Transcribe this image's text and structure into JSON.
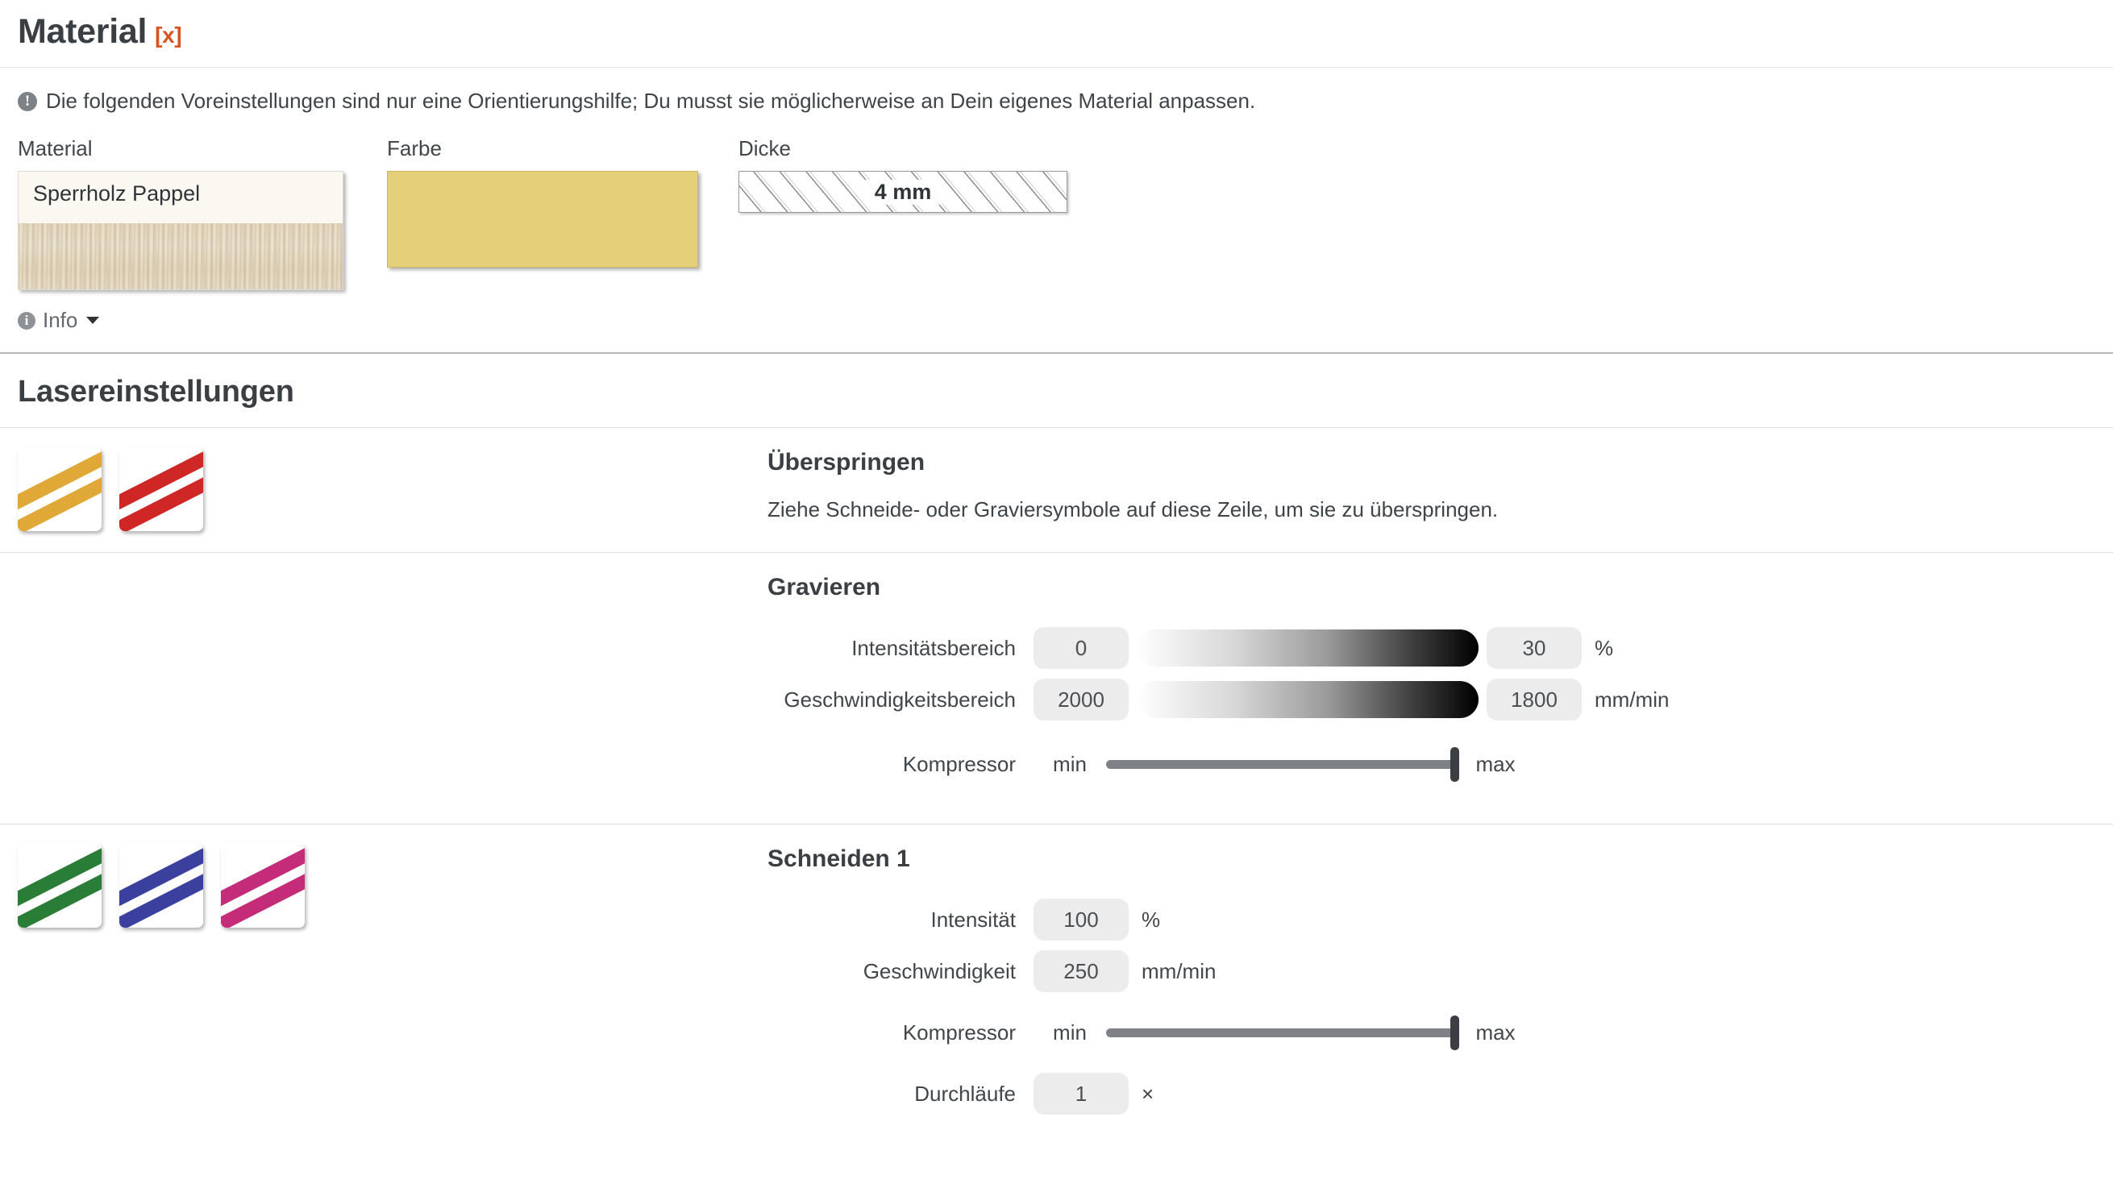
{
  "material_section": {
    "title": "Material",
    "close_tag": "[x]",
    "notice": {
      "icon": "exclamation-circle-icon",
      "text": "Die folgenden Voreinstellungen sind nur eine Orientierungshilfe; Du musst sie möglicherweise an Dein eigenes Material anpassen."
    },
    "fields": {
      "material": {
        "label": "Material",
        "value": "Sperrholz Pappel"
      },
      "color": {
        "label": "Farbe",
        "value_hex": "#e4d078"
      },
      "thickness": {
        "label": "Dicke",
        "value": "4 mm"
      }
    },
    "info_toggle": {
      "label": "Info",
      "icon": "info-circle-icon",
      "caret": "chevron-down-icon"
    }
  },
  "laser_section": {
    "title": "Lasereinstellungen",
    "rows": [
      {
        "id": "skip",
        "title": "Überspringen",
        "description": "Ziehe Schneide- oder Graviersymbole auf diese Zeile, um sie zu überspringen.",
        "tiles": [
          {
            "name": "stripe-tile-orange",
            "color": "#e0a836"
          },
          {
            "name": "stripe-tile-red",
            "color": "#cf2626"
          }
        ],
        "params": []
      },
      {
        "id": "engrave",
        "title": "Gravieren",
        "description": "",
        "tiles": [],
        "params": [
          {
            "type": "range",
            "label": "Intensitätsbereich",
            "from": "0",
            "to": "30",
            "unit": "%"
          },
          {
            "type": "range",
            "label": "Geschwindigkeitsbereich",
            "from": "2000",
            "to": "1800",
            "unit": "mm/min"
          },
          {
            "type": "slider",
            "label": "Kompressor",
            "min_label": "min",
            "max_label": "max",
            "position": "max"
          }
        ]
      },
      {
        "id": "cut-1",
        "title": "Schneiden 1",
        "description": "",
        "tiles": [
          {
            "name": "stripe-tile-green",
            "color": "#2a7d36"
          },
          {
            "name": "stripe-tile-blue",
            "color": "#3b3f9e"
          },
          {
            "name": "stripe-tile-magenta",
            "color": "#c42b79"
          }
        ],
        "params": [
          {
            "type": "value",
            "label": "Intensität",
            "value": "100",
            "unit": "%"
          },
          {
            "type": "value",
            "label": "Geschwindigkeit",
            "value": "250",
            "unit": "mm/min"
          },
          {
            "type": "slider",
            "label": "Kompressor",
            "min_label": "min",
            "max_label": "max",
            "position": "max"
          },
          {
            "type": "value",
            "label": "Durchläufe",
            "value": "1",
            "unit": "×"
          }
        ]
      }
    ]
  }
}
